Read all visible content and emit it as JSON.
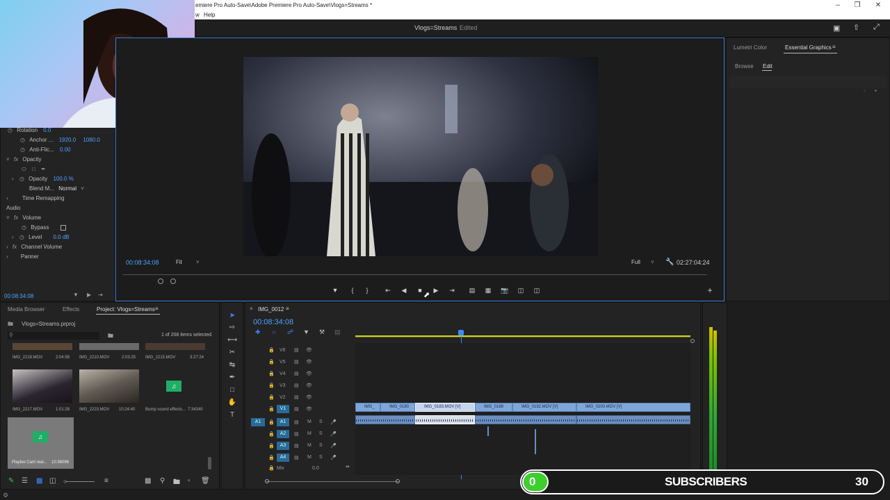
{
  "window": {
    "title": "emiere Pro Auto-Save\\Adobe Premiere Pro Auto-Save\\Vlogs=Streams *",
    "menu_visible": [
      "w",
      "Help"
    ],
    "sequence_title": "Vlogs=Streams",
    "sequence_status": "Edited"
  },
  "right_panel": {
    "tabs": [
      "Lumetri Color",
      "Essential Graphics"
    ],
    "active_tab": "Essential Graphics",
    "subtabs": [
      "Browse",
      "Edit"
    ],
    "active_subtab": "Edit"
  },
  "effect_controls": {
    "rows": [
      {
        "label": "Rotation",
        "value": "0.0"
      },
      {
        "label": "Anchor ...",
        "value": "1920.0",
        "value2": "1080.0"
      },
      {
        "label": "Anti-Flic...",
        "value": "0.00"
      },
      {
        "label": "Opacity",
        "is_section": true
      },
      {
        "label": "Opacity",
        "value": "100.0 %"
      },
      {
        "label": "Blend M...",
        "value": "Normal"
      },
      {
        "label": "Time Remapping",
        "is_section": true
      },
      {
        "label": "Volume",
        "is_section": true
      },
      {
        "label": "Bypass"
      },
      {
        "label": "Level",
        "value": "0.0 dB"
      },
      {
        "label": "Channel Volume",
        "is_section": true
      },
      {
        "label": "Panner",
        "is_section": true
      }
    ],
    "audio_header": "Audio",
    "timecode": "00:08:34:08"
  },
  "program_monitor": {
    "timecode": "00:08:34:08",
    "fit": "Fit",
    "resolution": "Full",
    "duration": "02:27:04:24"
  },
  "project_panel": {
    "tabs": [
      "Media Browser",
      "Effects",
      "Project: Vlogs=Streams"
    ],
    "active_tab": "Project: Vlogs=Streams",
    "project_file": "Vlogs=Streams.prproj",
    "selection": "1 of 208 items selected",
    "items_row1": [
      {
        "name": "IMG_2218.MOV",
        "duration": "2:04:58"
      },
      {
        "name": "IMG_2210.MOV",
        "duration": "2:03:25"
      },
      {
        "name": "IMG_2215.MOV",
        "duration": "3:27:24"
      }
    ],
    "items_row2": [
      {
        "name": "IMG_2217.MOV",
        "duration": "1:01:28"
      },
      {
        "name": "IMG_2223.MOV",
        "duration": "10:24:40"
      },
      {
        "name": "Bump sound effects...",
        "duration": "7:34340"
      }
    ],
    "items_row3": [
      {
        "name": "Playboi Carti real...",
        "duration": "10:36096"
      }
    ]
  },
  "timeline": {
    "sequence_tab": "IMG_0012",
    "timecode": "00:08:34:08",
    "video_tracks": [
      "V6",
      "V5",
      "V4",
      "V3",
      "V2",
      "V1"
    ],
    "audio_tracks": [
      "A1",
      "A2",
      "A3",
      "A4"
    ],
    "mix_label": "Mix",
    "mix_value": "0.0",
    "clips": [
      {
        "name": "IMG_"
      },
      {
        "name": "IMG_0180"
      },
      {
        "name": "IMG_0183.MOV [V]"
      },
      {
        "name": "IMG_0188"
      },
      {
        "name": "IMG_0192.MOV [V]"
      },
      {
        "name": "IMG_0200.MOV [V]"
      }
    ]
  },
  "overlay": {
    "subscriber_count": "0",
    "label": "SUBSCRIBERS",
    "goal": "30",
    "colors": {
      "accent": "#3ccf2d",
      "bar": "#1a1a1a"
    }
  }
}
